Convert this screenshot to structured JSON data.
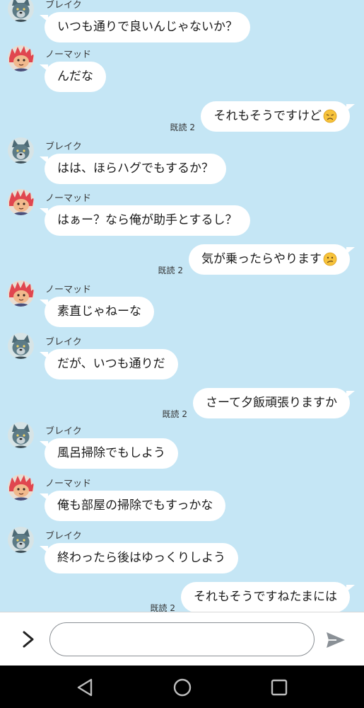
{
  "conversation": {
    "messages": [
      {
        "dir": "in",
        "sender": "ブレイク",
        "avatar": "blake",
        "text": "いつも通りで良いんじゃないか？"
      },
      {
        "dir": "in",
        "sender": "ノーマッド",
        "avatar": "nomad",
        "text": "んだな"
      },
      {
        "dir": "out",
        "text": "それもそうですけど",
        "emoji": "disappointed-face",
        "read": "既読 2"
      },
      {
        "dir": "in",
        "sender": "ブレイク",
        "avatar": "blake",
        "text": "はは、ほらハグでもするか？"
      },
      {
        "dir": "in",
        "sender": "ノーマッド",
        "avatar": "nomad",
        "text": "はぁー？なら俺が助手とするし？"
      },
      {
        "dir": "out",
        "text": "気が乗ったらやります",
        "emoji": "confused-face",
        "read": "既読 2"
      },
      {
        "dir": "in",
        "sender": "ノーマッド",
        "avatar": "nomad",
        "text": "素直じゃねーな"
      },
      {
        "dir": "in",
        "sender": "ブレイク",
        "avatar": "blake",
        "text": "だが、いつも通りだ"
      },
      {
        "dir": "out",
        "text": "さーて夕飯頑張りますか",
        "read": "既読 2"
      },
      {
        "dir": "in",
        "sender": "ブレイク",
        "avatar": "blake",
        "text": "風呂掃除でもしよう"
      },
      {
        "dir": "in",
        "sender": "ノーマッド",
        "avatar": "nomad",
        "text": "俺も部屋の掃除でもすっかな"
      },
      {
        "dir": "in",
        "sender": "ブレイク",
        "avatar": "blake",
        "text": "終わったら後はゆっくりしよう"
      },
      {
        "dir": "out",
        "text": "それもそうですねたまには",
        "read": "既読 2"
      }
    ]
  },
  "composer": {
    "input_value": "",
    "expand_icon": "chevron-right-icon",
    "send_icon": "send-icon"
  },
  "navbar": {
    "icons": [
      "back-triangle-icon",
      "home-circle-icon",
      "recents-square-icon"
    ]
  },
  "colors": {
    "background": "#c5e6f5",
    "bubble": "#ffffff",
    "nomad_hair": "#e0464f",
    "blake_fur": "#5d7b86"
  }
}
